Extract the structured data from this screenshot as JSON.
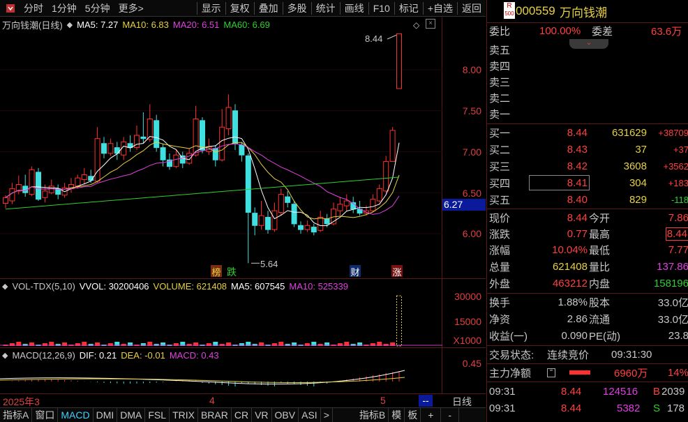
{
  "toolbar": {
    "left": [
      "分时",
      "1分钟",
      "5分钟",
      "更多>"
    ],
    "right": [
      "显示",
      "复权",
      "叠加",
      "多股",
      "统计",
      "画线",
      "F10",
      "标记",
      "+自选",
      "返回"
    ]
  },
  "stock": {
    "r_badge": "R",
    "r_num": "500",
    "code": "000559",
    "name": "万向钱潮"
  },
  "main_header": {
    "title": "万向钱潮(日线)",
    "ma5": "MA5: 7.27",
    "ma10": "MA10: 6.83",
    "ma20": "MA20: 6.51",
    "ma60": "MA60: 6.69"
  },
  "main_axis": [
    "8.00",
    "7.50",
    "7.00",
    "6.50",
    "6.00"
  ],
  "current_price_tag": "6.27",
  "annotations": {
    "high": "8.44",
    "low": "5.64",
    "tag_bang": "榜",
    "tag_die": "跌",
    "tag_cai": "财",
    "tag_zhang": "涨"
  },
  "vol_header": {
    "title": "VOL-TDX(5,10)",
    "vvol": "VVOL: 30200406",
    "volume": "VOLUME: 621408",
    "ma5": "MA5: 607545",
    "ma10": "MA10: 525339"
  },
  "vol_axis": [
    "30000",
    "15000",
    "X1000"
  ],
  "macd_header": {
    "title": "MACD(12,26,9)",
    "dif": "DIF: 0.21",
    "dea": "DEA: -0.01",
    "macd": "MACD: 0.43"
  },
  "macd_axis": [
    "0.45"
  ],
  "date_axis": {
    "d1": "2025年3",
    "d2": "4",
    "d3": "5",
    "period": "日线",
    "dash": "--"
  },
  "bottom_tabs": [
    "指标A",
    "窗口",
    "MACD",
    "DMI",
    "DMA",
    "FSL",
    "TRIX",
    "BRAR",
    "CR",
    "VR",
    "OBV",
    "ASI",
    ">",
    "指标B",
    "模",
    "板",
    "+",
    "-"
  ],
  "order_book": {
    "weibi_label": "委比",
    "weibi_val": "100.00%",
    "weicha_label": "委差",
    "weicha_val": "63.6万",
    "sells": [
      "卖五",
      "卖四",
      "卖三",
      "卖二",
      "卖一"
    ],
    "buys": [
      {
        "label": "买一",
        "price": "8.44",
        "vol": "631629",
        "chg": "+38709"
      },
      {
        "label": "买二",
        "price": "8.43",
        "vol": "37",
        "chg": "+37"
      },
      {
        "label": "买三",
        "price": "8.42",
        "vol": "3608",
        "chg": "+3562"
      },
      {
        "label": "买四",
        "price": "8.41",
        "vol": "304",
        "chg": "+183"
      },
      {
        "label": "买五",
        "price": "8.40",
        "vol": "829",
        "chg": "-118"
      }
    ]
  },
  "quote": [
    {
      "l1": "现价",
      "v1": "8.44",
      "l2": "今开",
      "v2": "7.86"
    },
    {
      "l1": "涨跌",
      "v1": "0.77",
      "l2": "最高",
      "v2": "8.44"
    },
    {
      "l1": "涨幅",
      "v1": "10.04%",
      "l2": "最低",
      "v2": "7.77"
    },
    {
      "l1": "总量",
      "v1": "621408",
      "l2": "量比",
      "v2": "137.86"
    },
    {
      "l1": "外盘",
      "v1": "463212",
      "l2": "内盘",
      "v2": "158196"
    }
  ],
  "fund": [
    {
      "l1": "换手",
      "v1": "1.88%",
      "l2": "股本",
      "v2": "33.0亿"
    },
    {
      "l1": "净资",
      "v1": "2.86",
      "l2": "流通",
      "v2": "33.0亿"
    },
    {
      "l1": "收益(一)",
      "v1": "0.090",
      "l2": "PE(动)",
      "v2": "23.8"
    }
  ],
  "trade_status": {
    "label": "交易状态:",
    "value": "连续竞价",
    "time": "09:31:30"
  },
  "main_flow": {
    "label": "主力净额",
    "value": "6960万",
    "pct": "14%"
  },
  "ticks": [
    {
      "time": "09:31",
      "price": "8.44",
      "vol": "124516",
      "side": "B",
      "num": "2039"
    },
    {
      "time": "09:31",
      "price": "8.44",
      "vol": "5382",
      "side": "S",
      "num": "178"
    }
  ],
  "colors": {
    "up": "#ff3030",
    "down": "#40e0e0",
    "ma5": "#ffffff",
    "ma10": "#e8d040",
    "ma20": "#e040e0",
    "ma60": "#30d030"
  }
}
